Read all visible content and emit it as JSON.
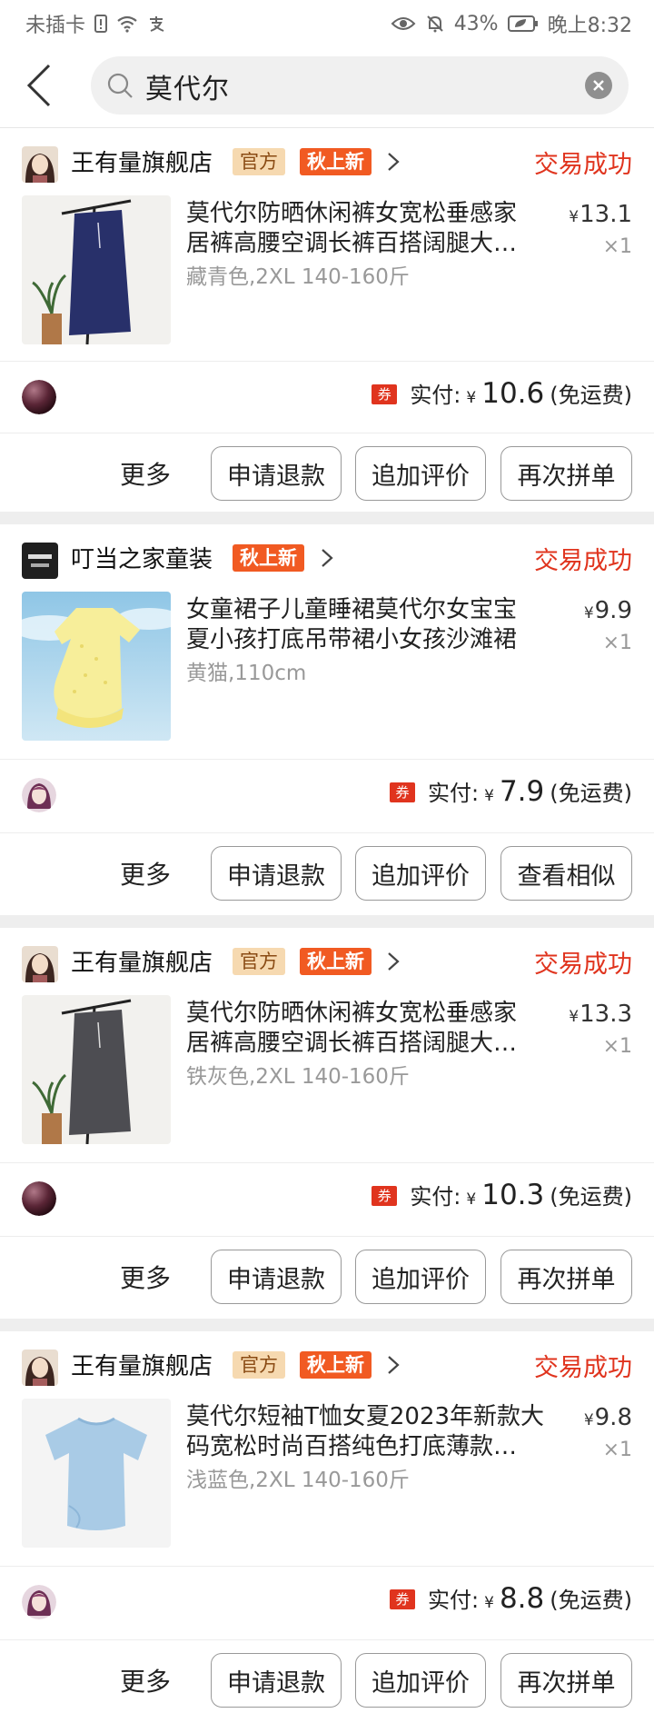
{
  "status_bar": {
    "carrier": "未插卡",
    "battery": "43%",
    "time": "晚上8:32",
    "icons": [
      "sim-alert-icon",
      "wifi-icon",
      "alipay-icon",
      "eye-icon",
      "mute-icon",
      "battery-icon"
    ]
  },
  "search": {
    "query": "莫代尔",
    "icons": [
      "back-arrow-icon",
      "search-icon",
      "clear-icon"
    ]
  },
  "colors": {
    "accent": "#e0341e",
    "autumn_badge": "#f15a22",
    "official_badge_bg": "#f6d9b0"
  },
  "orders": [
    {
      "shop_name": "王有量旗舰店",
      "official_badge": "官方",
      "season_badge": "秋上新",
      "status": "交易成功",
      "title_line1": "莫代尔防晒休闲裤女宽松垂感家",
      "title_line2": "居裤高腰空调长裤百搭阔腿大…",
      "spec": "藏青色,2XL 140-160斤",
      "price_symbol": "¥",
      "price": "13.1",
      "qty": "×1",
      "coupon": "券",
      "pay_label": "实付:",
      "pay_symbol": "¥",
      "pay_amount": "10.6",
      "pay_note": "(免运费)",
      "more": "更多",
      "btn1": "申请退款",
      "btn2": "追加评价",
      "btn3": "再次拼单"
    },
    {
      "shop_name": "叮当之家童装",
      "season_badge": "秋上新",
      "status": "交易成功",
      "title_line1": "女童裙子儿童睡裙莫代尔女宝宝",
      "title_line2": "夏小孩打底吊带裙小女孩沙滩裙",
      "spec": "黄猫,110cm",
      "price_symbol": "¥",
      "price": "9.9",
      "qty": "×1",
      "coupon": "券",
      "pay_label": "实付:",
      "pay_symbol": "¥",
      "pay_amount": "7.9",
      "pay_note": "(免运费)",
      "more": "更多",
      "btn1": "申请退款",
      "btn2": "追加评价",
      "btn3": "查看相似"
    },
    {
      "shop_name": "王有量旗舰店",
      "official_badge": "官方",
      "season_badge": "秋上新",
      "status": "交易成功",
      "title_line1": "莫代尔防晒休闲裤女宽松垂感家",
      "title_line2": "居裤高腰空调长裤百搭阔腿大…",
      "spec": "铁灰色,2XL 140-160斤",
      "price_symbol": "¥",
      "price": "13.3",
      "qty": "×1",
      "coupon": "券",
      "pay_label": "实付:",
      "pay_symbol": "¥",
      "pay_amount": "10.3",
      "pay_note": "(免运费)",
      "more": "更多",
      "btn1": "申请退款",
      "btn2": "追加评价",
      "btn3": "再次拼单"
    },
    {
      "shop_name": "王有量旗舰店",
      "official_badge": "官方",
      "season_badge": "秋上新",
      "status": "交易成功",
      "title_line1": "莫代尔短袖T恤女夏2023年新款大",
      "title_line2": "码宽松时尚百搭纯色打底薄款…",
      "spec": "浅蓝色,2XL 140-160斤",
      "price_symbol": "¥",
      "price": "9.8",
      "qty": "×1",
      "coupon": "券",
      "pay_label": "实付:",
      "pay_symbol": "¥",
      "pay_amount": "8.8",
      "pay_note": "(免运费)",
      "more": "更多",
      "btn1": "申请退款",
      "btn2": "追加评价",
      "btn3": "再次拼单"
    }
  ]
}
